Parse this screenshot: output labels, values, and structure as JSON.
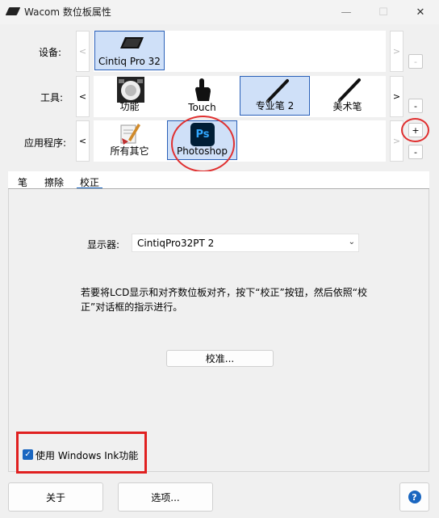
{
  "window": {
    "title": "Wacom 数位板属性"
  },
  "rows": {
    "device": {
      "label": "设备:",
      "items": [
        "Cintiq Pro 32"
      ]
    },
    "tool": {
      "label": "工具:",
      "items": [
        "功能",
        "Touch",
        "专业笔 2",
        "美术笔"
      ]
    },
    "application": {
      "label": "应用程序:",
      "items": [
        "所有其它",
        "Photoshop"
      ]
    }
  },
  "controls": {
    "left": "<",
    "right": ">",
    "add": "+",
    "remove": "-",
    "close": "✕",
    "minimize": "—",
    "maximize": "☐"
  },
  "tabs": [
    "笔",
    "擦除",
    "校正"
  ],
  "calibration": {
    "display_label": "显示器:",
    "display_value": "CintiqPro32PT 2",
    "description": "若要将LCD显示和对齐数位板对齐，按下“校正”按钮，然后依照“校正”对话框的指示进行。",
    "calibrate_button": "校准..."
  },
  "windows_ink": {
    "label": "使用 Windows Ink功能",
    "checked": true
  },
  "footer": {
    "about": "关于",
    "options": "选项...",
    "help": "?"
  },
  "colors": {
    "accent": "#1a66c0",
    "highlight_red": "#e02020",
    "photoshop_bg": "#001e36",
    "photoshop_fg": "#31a8ff"
  }
}
